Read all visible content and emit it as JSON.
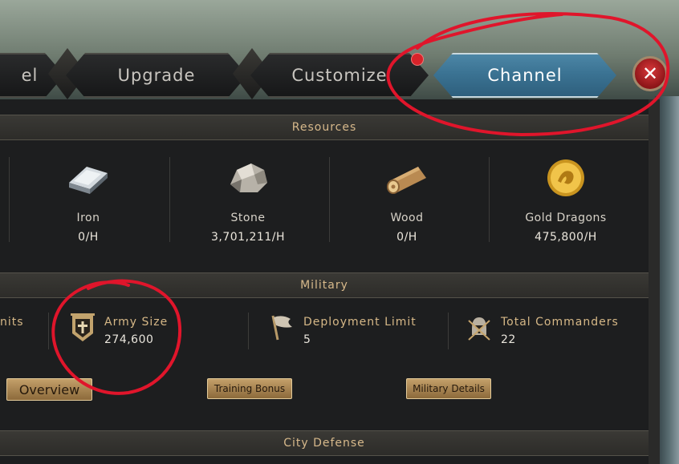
{
  "tabs": [
    {
      "label": "el"
    },
    {
      "label": "Upgrade"
    },
    {
      "label": "Customize"
    },
    {
      "label": "Channel",
      "active": true
    }
  ],
  "sections": {
    "resources": "Resources",
    "military": "Military",
    "city_defense": "City Defense"
  },
  "resources": [
    {
      "name": "Iron",
      "value": "0/H",
      "icon": "iron-ingot-icon"
    },
    {
      "name": "Stone",
      "value": "3,701,211/H",
      "icon": "stone-icon"
    },
    {
      "name": "Wood",
      "value": "0/H",
      "icon": "wood-log-icon"
    },
    {
      "name": "Gold Dragons",
      "value": "475,800/H",
      "icon": "gold-dragon-coin-icon"
    }
  ],
  "military": {
    "units_label": "nits",
    "army_size": {
      "label": "Army Size",
      "value": "274,600",
      "icon": "army-banner-icon"
    },
    "deployment_limit": {
      "label": "Deployment Limit",
      "value": "5",
      "icon": "flag-icon"
    },
    "total_commanders": {
      "label": "Total Commanders",
      "value": "22",
      "icon": "commander-helmet-icon"
    }
  },
  "buttons": {
    "overview": "Overview",
    "training_bonus": "Training Bonus",
    "military_details": "Military Details"
  },
  "colors": {
    "active_tab": "#3b7393",
    "section_title": "#d7b98b",
    "annotation": "#e0152b",
    "close_button": "#c62a2e"
  }
}
